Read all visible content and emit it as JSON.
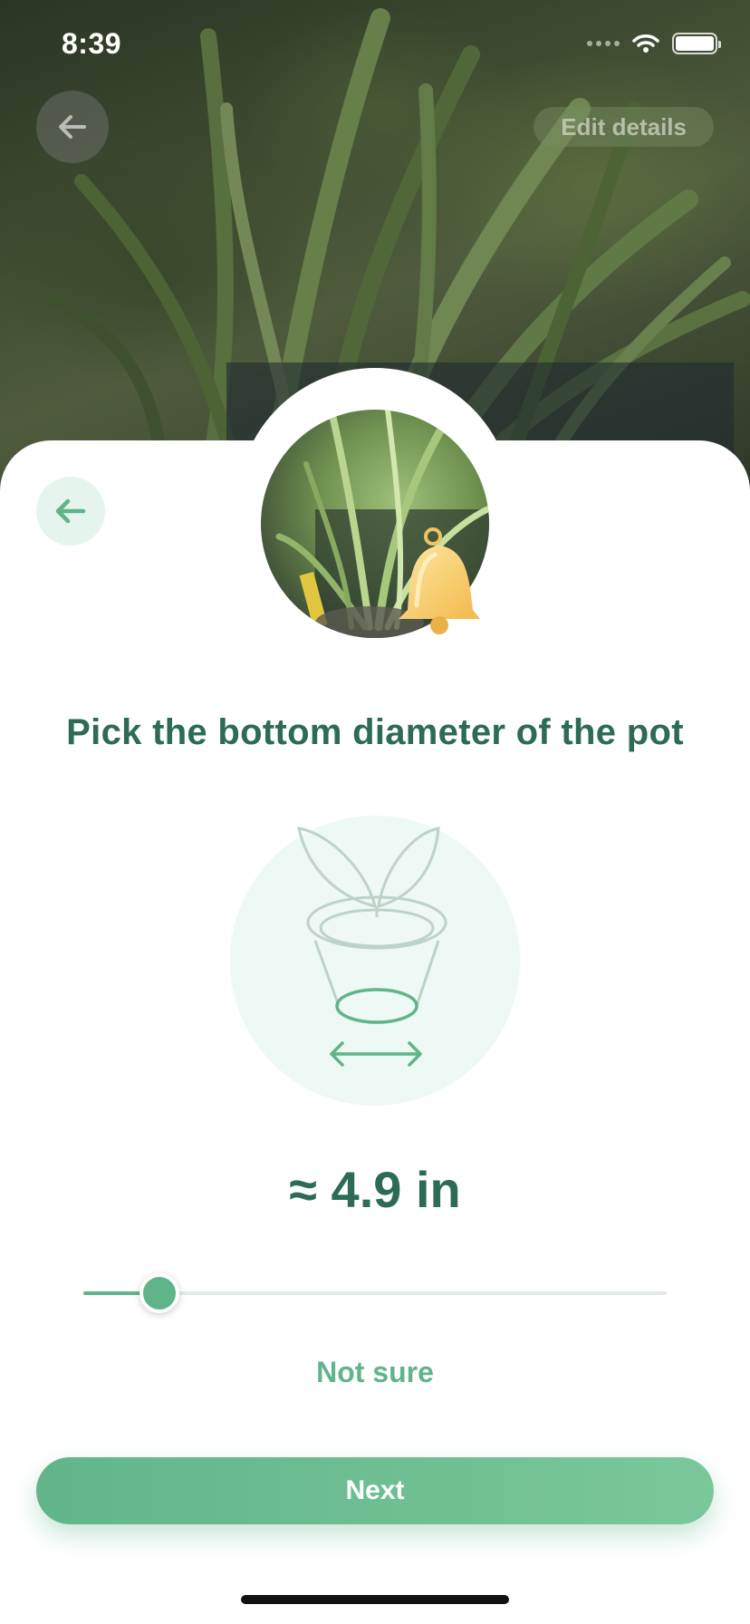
{
  "status_bar": {
    "time": "8:39"
  },
  "header": {
    "edit_details_label": "Edit details"
  },
  "main": {
    "title": "Pick the bottom diameter of the pot",
    "value_display": "≈ 4.9 in",
    "slider_fraction": 0.13,
    "not_sure_label": "Not sure",
    "next_label": "Next"
  },
  "colors": {
    "accent_green": "#5fb48a",
    "title_green": "#2d6a57",
    "light_green_bg": "#e6f4ee"
  },
  "icons": [
    "back-arrow-icon",
    "bell-icon",
    "pot-diameter-icon",
    "wifi-icon",
    "battery-icon"
  ]
}
